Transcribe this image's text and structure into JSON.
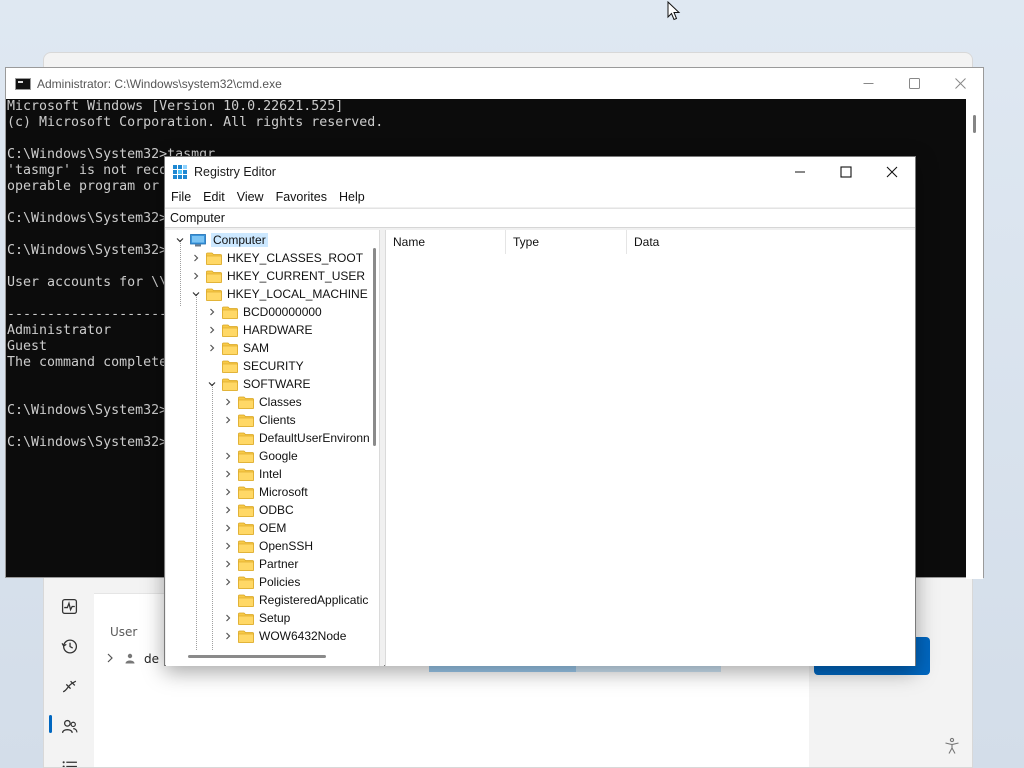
{
  "task_manager": {
    "column_user": "User",
    "row_user_label": "de",
    "nav_icons": [
      "activity-icon",
      "history-icon",
      "startup-icon",
      "users-icon",
      "details-icon"
    ]
  },
  "cmd": {
    "title": "Administrator: C:\\Windows\\system32\\cmd.exe",
    "lines": [
      "Microsoft Windows [Version 10.0.22621.525]",
      "(c) Microsoft Corporation. All rights reserved.",
      "",
      "C:\\Windows\\System32>tasmgr",
      "'tasmgr' is not reco",
      "operable program or",
      "",
      "C:\\Windows\\System32>",
      "",
      "C:\\Windows\\System32>",
      "",
      "User accounts for \\\\",
      "",
      "-------------------------",
      "Administrator",
      "Guest",
      "The command complete",
      "",
      "",
      "C:\\Windows\\System32>",
      "",
      "C:\\Windows\\System32>"
    ]
  },
  "registry": {
    "title": "Registry Editor",
    "menu": [
      "File",
      "Edit",
      "View",
      "Favorites",
      "Help"
    ],
    "address": "Computer",
    "tree": [
      {
        "label": "Computer",
        "depth": 0,
        "state": "expanded",
        "icon": "computer",
        "selected": true
      },
      {
        "label": "HKEY_CLASSES_ROOT",
        "depth": 1,
        "state": "collapsed",
        "icon": "folder"
      },
      {
        "label": "HKEY_CURRENT_USER",
        "depth": 1,
        "state": "collapsed",
        "icon": "folder"
      },
      {
        "label": "HKEY_LOCAL_MACHINE",
        "depth": 1,
        "state": "expanded",
        "icon": "folder"
      },
      {
        "label": "BCD00000000",
        "depth": 2,
        "state": "collapsed",
        "icon": "folder"
      },
      {
        "label": "HARDWARE",
        "depth": 2,
        "state": "collapsed",
        "icon": "folder"
      },
      {
        "label": "SAM",
        "depth": 2,
        "state": "collapsed",
        "icon": "folder"
      },
      {
        "label": "SECURITY",
        "depth": 2,
        "state": "none",
        "icon": "folder"
      },
      {
        "label": "SOFTWARE",
        "depth": 2,
        "state": "expanded",
        "icon": "folder"
      },
      {
        "label": "Classes",
        "depth": 3,
        "state": "collapsed",
        "icon": "folder"
      },
      {
        "label": "Clients",
        "depth": 3,
        "state": "collapsed",
        "icon": "folder"
      },
      {
        "label": "DefaultUserEnvironn",
        "depth": 3,
        "state": "none",
        "icon": "folder"
      },
      {
        "label": "Google",
        "depth": 3,
        "state": "collapsed",
        "icon": "folder"
      },
      {
        "label": "Intel",
        "depth": 3,
        "state": "collapsed",
        "icon": "folder"
      },
      {
        "label": "Microsoft",
        "depth": 3,
        "state": "collapsed",
        "icon": "folder"
      },
      {
        "label": "ODBC",
        "depth": 3,
        "state": "collapsed",
        "icon": "folder"
      },
      {
        "label": "OEM",
        "depth": 3,
        "state": "collapsed",
        "icon": "folder"
      },
      {
        "label": "OpenSSH",
        "depth": 3,
        "state": "collapsed",
        "icon": "folder"
      },
      {
        "label": "Partner",
        "depth": 3,
        "state": "collapsed",
        "icon": "folder"
      },
      {
        "label": "Policies",
        "depth": 3,
        "state": "collapsed",
        "icon": "folder"
      },
      {
        "label": "RegisteredApplicatic",
        "depth": 3,
        "state": "none",
        "icon": "folder"
      },
      {
        "label": "Setup",
        "depth": 3,
        "state": "collapsed",
        "icon": "folder"
      },
      {
        "label": "WOW6432Node",
        "depth": 3,
        "state": "collapsed",
        "icon": "folder"
      }
    ],
    "columns": [
      "Name",
      "Type",
      "Data"
    ]
  },
  "colors": {
    "accent": "#0067c0",
    "folder": "#f7c948",
    "selection": "#cce8ff"
  }
}
